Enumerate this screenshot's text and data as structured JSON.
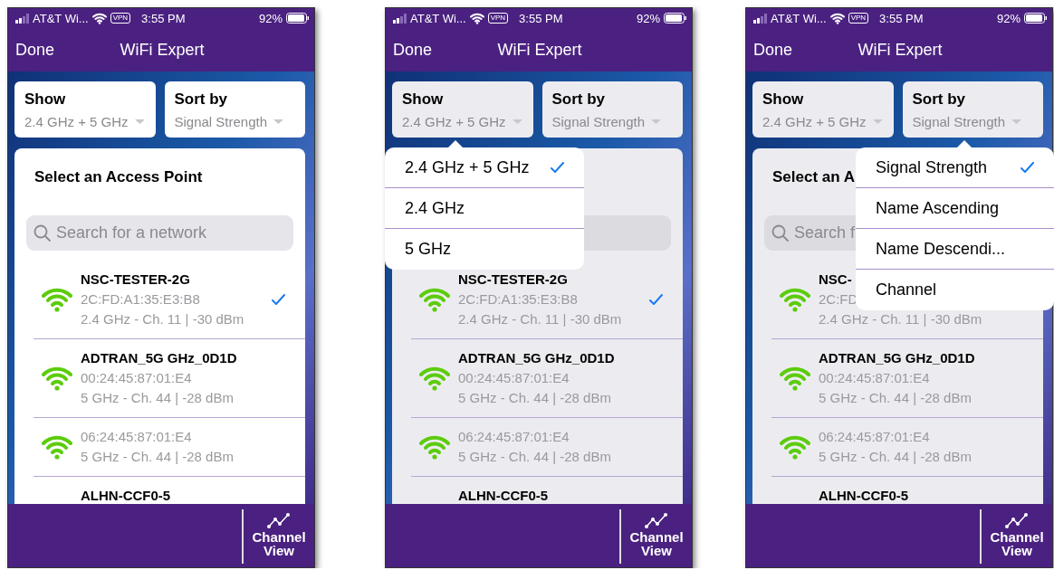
{
  "phones": [
    {
      "status_bar": {
        "carrier": "AT&T Wi...",
        "vpn": "VPN",
        "time": "3:55 PM",
        "battery": "92%"
      },
      "nav": {
        "done": "Done",
        "title": "WiFi Expert"
      },
      "show": {
        "label": "Show",
        "value": "2.4 GHz + 5 GHz"
      },
      "sort": {
        "label": "Sort by",
        "value": "Signal Strength"
      },
      "list": {
        "title": "Select an Access Point",
        "search_placeholder": "Search for a network"
      },
      "networks": [
        {
          "name": "NSC-TESTER-2G",
          "mac": "2C:FD:A1:35:E3:B8",
          "detail": "2.4 GHz - Ch. 11 | -30 dBm",
          "selected": true
        },
        {
          "name": "ADTRAN_5G GHz_0D1D",
          "mac": "00:24:45:87:01:E4",
          "detail": "5 GHz - Ch. 44 | -28 dBm",
          "selected": false
        },
        {
          "mac": "06:24:45:87:01:E4",
          "detail": "5 GHz - Ch. 44 | -28 dBm",
          "selected": false
        },
        {
          "name": "ALHN-CCF0-5",
          "selected": false
        }
      ],
      "footer": {
        "button": "Channel View"
      }
    },
    {
      "status_bar": {
        "carrier": "AT&T Wi...",
        "vpn": "VPN",
        "time": "3:55 PM",
        "battery": "92%"
      },
      "nav": {
        "done": "Done",
        "title": "WiFi Expert"
      },
      "show": {
        "label": "Show",
        "value": "2.4 GHz + 5 GHz",
        "menu": [
          {
            "label": "2.4 GHz + 5 GHz",
            "selected": true
          },
          {
            "label": "2.4 GHz",
            "selected": false
          },
          {
            "label": "5 GHz",
            "selected": false
          }
        ]
      },
      "sort": {
        "label": "Sort by",
        "value": "Signal Strength"
      },
      "networks": [
        {
          "name": "NSC-TESTER-2G",
          "mac": "2C:FD:A1:35:E3:B8",
          "detail": "2.4 GHz - Ch. 11 | -30 dBm",
          "selected": true
        },
        {
          "name": "ADTRAN_5G GHz_0D1D",
          "mac": "00:24:45:87:01:E4",
          "detail": "5 GHz - Ch. 44 | -28 dBm",
          "selected": false
        },
        {
          "mac": "06:24:45:87:01:E4",
          "detail": "5 GHz - Ch. 44 | -28 dBm",
          "selected": false
        },
        {
          "name": "ALHN-CCF0-5",
          "selected": false
        }
      ],
      "footer": {
        "button": "Channel View"
      }
    },
    {
      "status_bar": {
        "carrier": "AT&T Wi...",
        "vpn": "VPN",
        "time": "3:55 PM",
        "battery": "92%"
      },
      "nav": {
        "done": "Done",
        "title": "WiFi Expert"
      },
      "show": {
        "label": "Show",
        "value": "2.4 GHz + 5 GHz"
      },
      "sort": {
        "label": "Sort by",
        "value": "Signal Strength",
        "menu": [
          {
            "label": "Signal Strength",
            "selected": true
          },
          {
            "label": "Name Ascending",
            "selected": false
          },
          {
            "label": "Name Descendi...",
            "selected": false
          },
          {
            "label": "Channel",
            "selected": false
          }
        ]
      },
      "list": {
        "title": "Select an A",
        "search_placeholder": "Search f"
      },
      "networks": [
        {
          "name": "NSC-",
          "mac": "2C:FD",
          "detail": "2.4 GHz - Ch. 11 | -30 dBm"
        },
        {
          "name": "ADTRAN_5G GHz_0D1D",
          "mac": "00:24:45:87:01:E4",
          "detail": "5 GHz - Ch. 44 | -28 dBm",
          "selected": false
        },
        {
          "mac": "06:24:45:87:01:E4",
          "detail": "5 GHz - Ch. 44 | -28 dBm",
          "selected": false
        },
        {
          "name": "ALHN-CCF0-5",
          "selected": false
        }
      ],
      "footer": {
        "button": "Channel View"
      }
    }
  ]
}
